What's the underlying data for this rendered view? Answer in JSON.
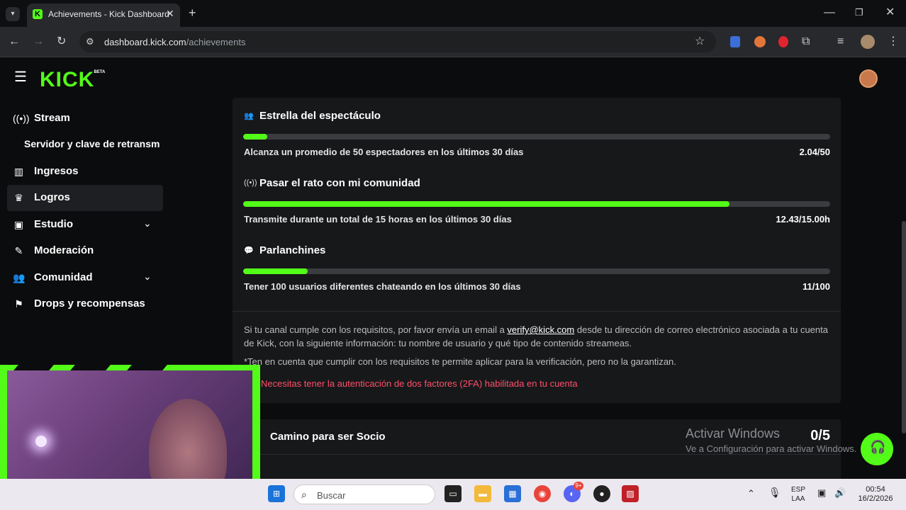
{
  "browser": {
    "tab_title": "Achievements - Kick Dashboard",
    "url_domain": "dashboard.kick.com",
    "url_path": "/achievements"
  },
  "brand": {
    "logo": "KICK",
    "logo_badge": "BETA",
    "accent": "#53fc18"
  },
  "sidebar": {
    "items": [
      {
        "label": "Stream",
        "icon": "broadcast-icon"
      },
      {
        "label": "Servidor y clave de retransm",
        "icon": ""
      },
      {
        "label": "Ingresos",
        "icon": "chart-icon"
      },
      {
        "label": "Logros",
        "icon": "trophy-icon"
      },
      {
        "label": "Estudio",
        "icon": "film-icon"
      },
      {
        "label": "Moderación",
        "icon": "wrench-icon"
      },
      {
        "label": "Comunidad",
        "icon": "users-icon"
      },
      {
        "label": "Drops y recompensas",
        "icon": "gift-icon"
      }
    ]
  },
  "achievements": [
    {
      "title": "Estrella del espectáculo",
      "icon": "users-icon",
      "desc": "Alcanza un promedio de 50 espectadores en los últimos 30 días",
      "value": "2.04/50",
      "progress": 0.0408
    },
    {
      "title": "Pasar el rato con mi comunidad",
      "icon": "broadcast-icon",
      "desc": "Transmite durante un total de 15 horas en los últimos 30 días",
      "value": "12.43/15.00h",
      "progress": 0.8287
    },
    {
      "title": "Parlanchines",
      "icon": "chat-icon",
      "desc": "Tener 100 usuarios diferentes chateando en los últimos 30 días",
      "value": "11/100",
      "progress": 0.11
    }
  ],
  "notes": {
    "line1_pre": "Si tu canal cumple con los requisitos, por favor envía un email a ",
    "email": "verify@kick.com",
    "line1_post": " desde tu dirección de correo electrónico asociada a tu cuenta de Kick, con la siguiente información: tu nombre de usuario y qué tipo de contenido streameas.",
    "line2": "*Ten en cuenta que cumplir con los requisitos te permite aplicar para la verificación, pero no la garantizan.",
    "warning": "Necesitas tener la autenticación de dos factores (2FA) habilitada en tu cuenta"
  },
  "partner": {
    "title": "Camino para ser Socio",
    "score": "0/5"
  },
  "windows_activation": {
    "title": "Activar Windows",
    "subtitle": "Ve a Configuración para activar Windows."
  },
  "taskbar": {
    "search_placeholder": "Buscar",
    "lang_top": "ESP",
    "lang_bottom": "LAA",
    "time": "00:54",
    "date": "16/2/2026",
    "discord_badge": "9+"
  }
}
